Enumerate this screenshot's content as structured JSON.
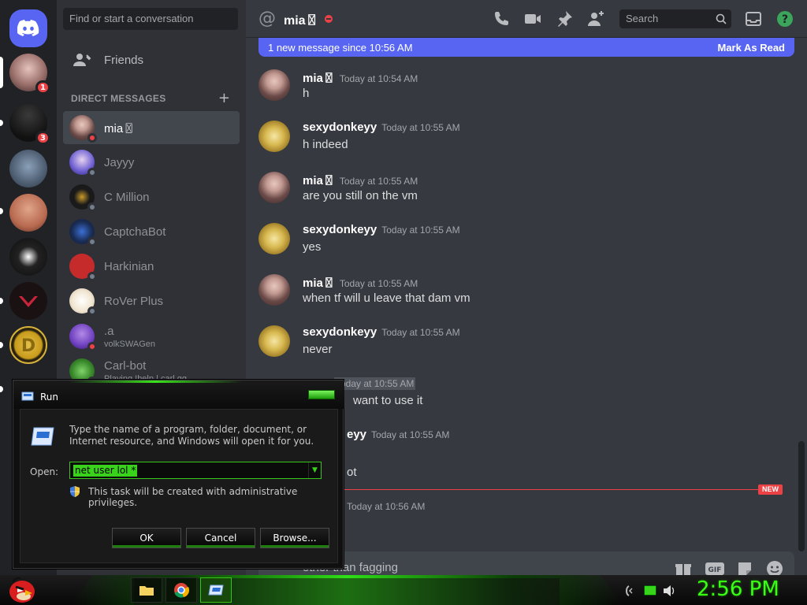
{
  "dm_sidebar": {
    "search_placeholder": "Find or start a conversation",
    "friends_label": "Friends",
    "direct_messages_header": "DIRECT MESSAGES",
    "add_dm_symbol": "+",
    "items": [
      {
        "name": "mia〿",
        "status": "dnd",
        "active": true
      },
      {
        "name": "Jayyy",
        "status": "offline"
      },
      {
        "name": "C Million",
        "status": "offline"
      },
      {
        "name": "CaptchaBot",
        "status": "offline"
      },
      {
        "name": "Harkinian",
        "status": "offline"
      },
      {
        "name": "RoVer Plus",
        "status": "offline"
      },
      {
        "name": ".a",
        "status": "dnd",
        "sub": "volkSWAGen"
      },
      {
        "name": "Carl-bot",
        "status": "offline",
        "sub": "Playing !help | carl.gg"
      }
    ]
  },
  "servers": {
    "badges": [
      "1",
      "3"
    ]
  },
  "chat_header": {
    "title": "mia〿",
    "search_placeholder": "Search",
    "icons": [
      "call-icon",
      "video-icon",
      "pin-icon",
      "add-member-icon",
      "inbox-icon",
      "help-icon"
    ]
  },
  "new_messages_bar": {
    "text": "1 new message since 10:56 AM",
    "action": "Mark As Read"
  },
  "messages": [
    {
      "author": "mia〿",
      "time": "Today at 10:54 AM",
      "text": "h"
    },
    {
      "author": "sexydonkeyy",
      "time": "Today at 10:55 AM",
      "text": "h indeed"
    },
    {
      "author": "mia〿",
      "time": "Today at 10:55 AM",
      "text": "are you still on the vm"
    },
    {
      "author": "sexydonkeyy",
      "time": "Today at 10:55 AM",
      "text": "yes"
    },
    {
      "author": "mia〿",
      "time": "Today at 10:55 AM",
      "text": "when tf will u leave that dam vm"
    },
    {
      "author": "sexydonkeyy",
      "time": "Today at 10:55 AM",
      "text": "never"
    },
    {
      "author": "",
      "time": "Today at 10:55 AM",
      "text": "want to use it"
    },
    {
      "author": "eyy",
      "time": "Today at 10:55 AM",
      "text": "ot"
    },
    {
      "author": "",
      "time": "Today at 10:56 AM",
      "text": ""
    }
  ],
  "new_divider_label": "NEW",
  "composer_text": "other than fagging",
  "run_dialog": {
    "title": "Run",
    "description": "Type the name of a program, folder, document, or Internet resource, and Windows will open it for you.",
    "open_label": "Open:",
    "input_value": "net user lol *",
    "admin_note": "This task will be created with administrative privileges.",
    "ok": "OK",
    "cancel": "Cancel",
    "browse": "Browse..."
  },
  "taskbar": {
    "clock": "2:56 PM",
    "accent": "#39ff14"
  },
  "colors": {
    "discord_blurple": "#5865f2",
    "dnd_red": "#ed4245"
  }
}
